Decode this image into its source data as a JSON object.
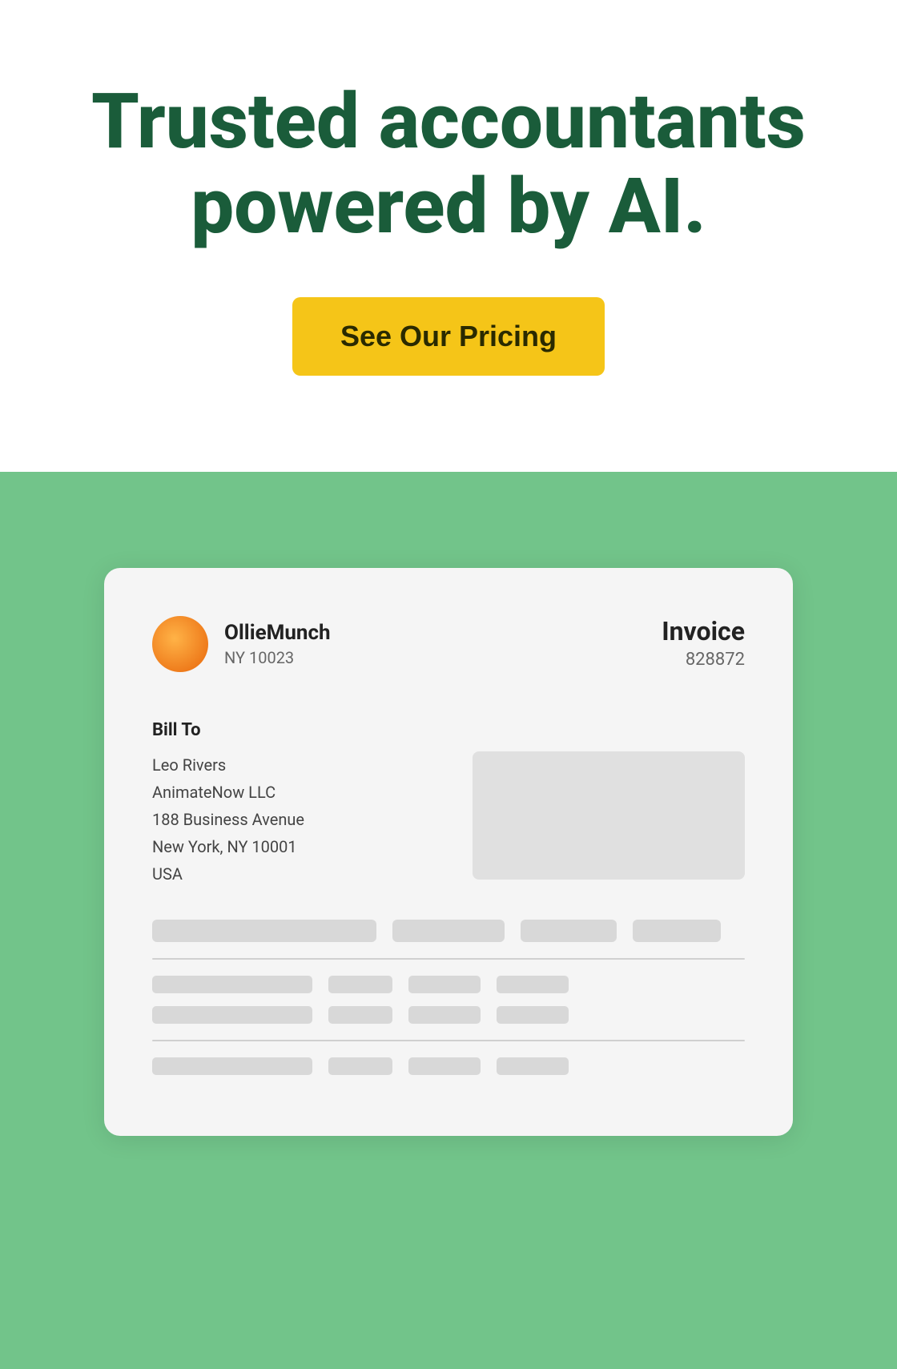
{
  "hero": {
    "title_line1": "Trusted accountants",
    "title_line2": "powered by AI.",
    "cta_label": "See Our Pricing"
  },
  "invoice_card": {
    "company": {
      "name": "OllieMunch",
      "location": "NY 10023"
    },
    "invoice_label": "Invoice",
    "invoice_number": "828872",
    "bill_to": {
      "label": "Bill To",
      "name": "Leo Rivers",
      "company": "AnimateNow LLC",
      "address_line1": "188 Business Avenue",
      "address_line2": "New York, NY 10001",
      "country": "USA"
    }
  }
}
